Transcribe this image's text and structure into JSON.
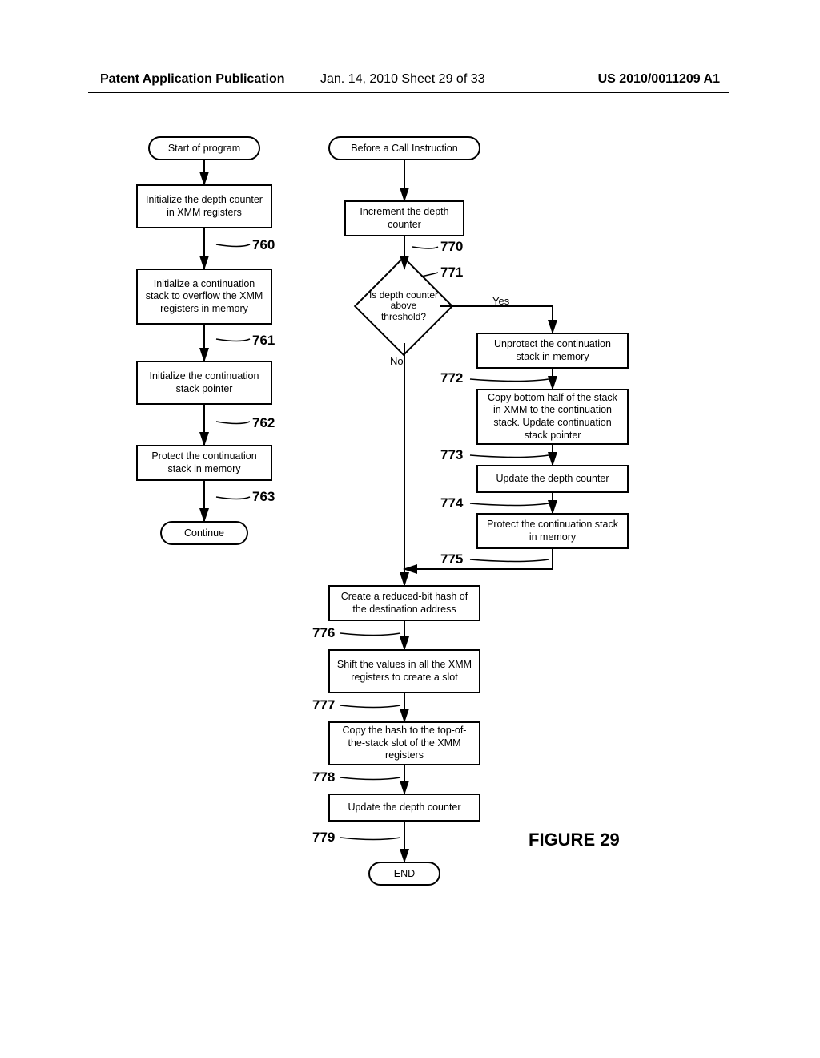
{
  "header": {
    "left": "Patent Application Publication",
    "center": "Jan. 14, 2010  Sheet 29 of 33",
    "right": "US 2010/0011209 A1"
  },
  "figure_title": "FIGURE 29",
  "left_flow": {
    "start": "Start of program",
    "step760": "Initialize the depth counter in XMM registers",
    "step761": "Initialize a continuation stack to overflow the XMM registers in memory",
    "step762": "Initialize the continuation stack pointer",
    "step763": "Protect the continuation stack in memory",
    "cont": "Continue"
  },
  "right_flow": {
    "start": "Before a Call Instruction",
    "step770": "Increment the depth counter",
    "decision": "Is depth counter above threshold?",
    "decision_yes": "Yes",
    "decision_no": "No",
    "step772": "Unprotect the continuation stack in memory",
    "step773": "Copy bottom half of the stack in XMM to the continuation stack. Update continuation stack pointer",
    "step774": "Update the depth counter",
    "step775": "Protect the continuation stack in memory",
    "step776": "Create a reduced-bit hash of the destination address",
    "step777": "Shift the values in all the XMM registers to create a slot",
    "step778": "Copy the hash to the top-of-the-stack slot of the XMM registers",
    "step779": "Update the depth counter",
    "end": "END"
  },
  "refs": {
    "r760": "760",
    "r761": "761",
    "r762": "762",
    "r763": "763",
    "r770": "770",
    "r771": "771",
    "r772": "772",
    "r773": "773",
    "r774": "774",
    "r775": "775",
    "r776": "776",
    "r777": "777",
    "r778": "778",
    "r779": "779"
  }
}
